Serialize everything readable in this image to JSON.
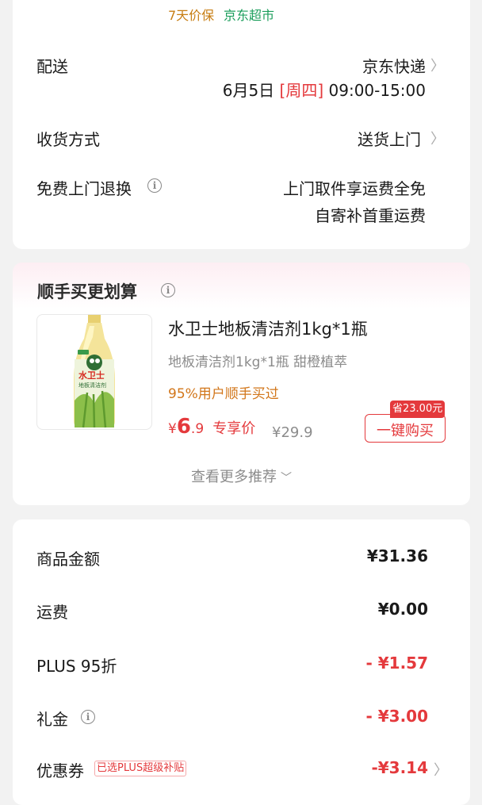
{
  "delivery_card": {
    "tag_price_protect": "7天价保",
    "tag_store": "京东超市",
    "delivery_label": "配送",
    "delivery_carrier": "京东快递",
    "delivery_date": "6月5日",
    "delivery_weekday": "[周四]",
    "delivery_time": "09:00-15:00",
    "receive_label": "收货方式",
    "receive_value": "送货上门",
    "return_label": "免费上门退换",
    "return_line1": "上门取件享运费全免",
    "return_line2": "自寄补首重运费"
  },
  "recommend": {
    "title": "顺手买更划算",
    "product_name": "水卫士地板清洁剂1kg*1瓶",
    "product_spec": "地板清洁剂1kg*1瓶 甜橙植萃",
    "product_stat": "95%用户顺手买过",
    "price_currency": "¥",
    "price_int": "6",
    "price_dec": ".9",
    "price_tag": "专享价",
    "original_price": "¥29.9",
    "save_badge": "省23.00元",
    "buy_button": "一键购买",
    "bottle_brand": "水卫士",
    "bottle_desc": "地板清洁剂",
    "more_link": "查看更多推荐"
  },
  "summary": {
    "rows": [
      {
        "label": "商品金额",
        "value": "¥31.36"
      },
      {
        "label": "运费",
        "value": "¥0.00"
      },
      {
        "label": "PLUS 95折",
        "value": "- ¥1.57"
      },
      {
        "label": "礼金",
        "value": "- ¥3.00"
      },
      {
        "label": "优惠券",
        "value": "-¥3.14"
      }
    ],
    "coupon_tag": "已选PLUS超级补贴"
  },
  "colors": {
    "accent_red": "#e4393c",
    "tag_orange": "#c77d12",
    "tag_green": "#1c9e5c"
  },
  "icons": [
    "info-icon",
    "chevron-right-icon",
    "chevron-down-icon"
  ]
}
